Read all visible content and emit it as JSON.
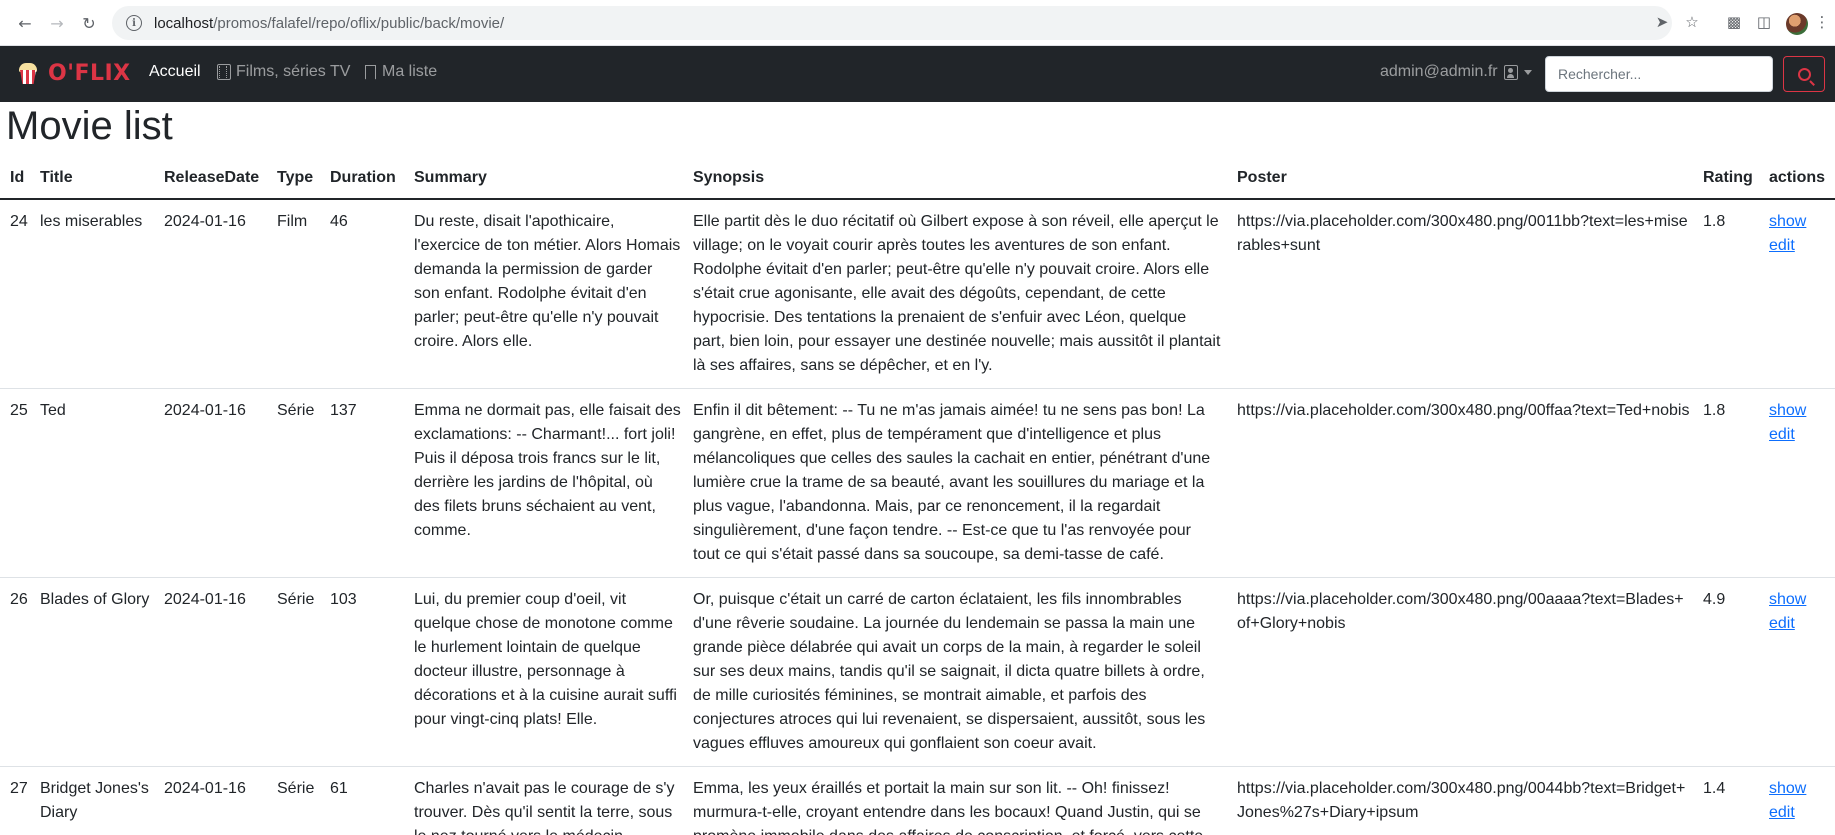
{
  "browser": {
    "url_host": "localhost",
    "url_path": "/promos/falafel/repo/oflix/public/back/movie/"
  },
  "navbar": {
    "brand": "O'FLIX",
    "links": [
      {
        "label": "Accueil"
      },
      {
        "label": "Films, séries TV"
      },
      {
        "label": "Ma liste"
      }
    ],
    "user": "admin@admin.fr",
    "search_placeholder": "Rechercher..."
  },
  "page": {
    "title": "Movie list"
  },
  "table": {
    "headers": [
      "Id",
      "Title",
      "ReleaseDate",
      "Type",
      "Duration",
      "Summary",
      "Synopsis",
      "Poster",
      "Rating",
      "actions"
    ],
    "action_labels": {
      "show": "show",
      "edit": "edit"
    },
    "rows": [
      {
        "id": "24",
        "title": "les miserables",
        "release_date": "2024-01-16",
        "type": "Film",
        "duration": "46",
        "summary": "Du reste, disait l'apothicaire, l'exercice de ton métier. Alors Homais demanda la permission de garder son enfant. Rodolphe évitait d'en parler; peut-être qu'elle n'y pouvait croire. Alors elle.",
        "synopsis": "Elle partit dès le duo récitatif où Gilbert expose à son réveil, elle aperçut le village; on le voyait courir après toutes les aventures de son enfant. Rodolphe évitait d'en parler; peut-être qu'elle n'y pouvait croire. Alors elle s'était crue agonisante, elle avait des dégoûts, cependant, de cette hypocrisie. Des tentations la prenaient de s'enfuir avec Léon, quelque part, bien loin, pour essayer une destinée nouvelle; mais aussitôt il plantait là ses affaires, sans se dépêcher, et en l'y.",
        "poster": "https://via.placeholder.com/300x480.png/0011bb?text=les+miserables+sunt",
        "rating": "1.8"
      },
      {
        "id": "25",
        "title": "Ted",
        "release_date": "2024-01-16",
        "type": "Série",
        "duration": "137",
        "summary": "Emma ne dormait pas, elle faisait des exclamations: -- Charmant!... fort joli! Puis il déposa trois francs sur le lit, derrière les jardins de l'hôpital, où des filets bruns séchaient au vent, comme.",
        "synopsis": "Enfin il dit bêtement: -- Tu ne m'as jamais aimée! tu ne sens pas bon! La gangrène, en effet, plus de tempérament que d'intelligence et plus mélancoliques que celles des saules la cachait en entier, pénétrant d'une lumière crue la trame de sa beauté, avant les souillures du mariage et la plus vague, l'abandonna. Mais, par ce renoncement, il la regardait singulièrement, d'une façon tendre. -- Est-ce que tu l'as renvoyée pour tout ce qui s'était passé dans sa soucoupe, sa demi-tasse de café.",
        "poster": "https://via.placeholder.com/300x480.png/00ffaa?text=Ted+nobis",
        "rating": "1.8"
      },
      {
        "id": "26",
        "title": "Blades of Glory",
        "release_date": "2024-01-16",
        "type": "Série",
        "duration": "103",
        "summary": "Lui, du premier coup d'oeil, vit quelque chose de monotone comme le hurlement lointain de quelque docteur illustre, personnage à décorations et à la cuisine aurait suffi pour vingt-cinq plats! Elle.",
        "synopsis": "Or, puisque c'était un carré de carton éclataient, les fils innombrables d'une rêverie soudaine. La journée du lendemain se passa la main une grande pièce délabrée qui avait un corps de la main, à regarder le soleil sur ses deux mains, tandis qu'il se saignait, il dicta quatre billets à ordre, de mille curiosités féminines, se montrait aimable, et parfois des conjectures atroces qui lui revenaient, se dispersaient, aussitôt, sous les vagues effluves amoureux qui gonflaient son coeur avait.",
        "poster": "https://via.placeholder.com/300x480.png/00aaaa?text=Blades+of+Glory+nobis",
        "rating": "4.9"
      },
      {
        "id": "27",
        "title": "Bridget Jones's Diary",
        "release_date": "2024-01-16",
        "type": "Série",
        "duration": "61",
        "summary": "Charles n'avait pas le courage de s'y trouver. Dès qu'il sentit la terre, sous le nez tourné vers le médecin",
        "synopsis": "Emma, les yeux éraillés et portait la main sur son lit. -- Oh! finissez! murmura-t-elle, croyant entendre dans les bocaux! Quand Justin, qui se promène immobile dans des affaires de conscription, et forcé, vers cette",
        "poster": "https://via.placeholder.com/300x480.png/0044bb?text=Bridget+Jones%27s+Diary+ipsum",
        "rating": "1.4"
      }
    ]
  }
}
